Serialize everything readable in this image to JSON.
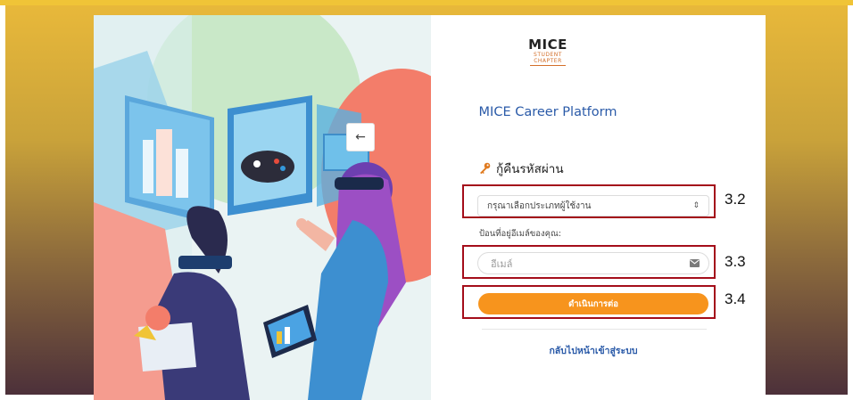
{
  "back_button": {
    "icon": "arrow-left-icon",
    "glyph": "←"
  },
  "logo": {
    "title": "MICE",
    "line1": "STUDENT",
    "line2": "CHAPTER"
  },
  "platform_title": "MICE Career Platform",
  "section": {
    "icon": "key-icon",
    "title": "กู้คืนรหัสผ่าน"
  },
  "user_type_select": {
    "selected": "กรุณาเลือกประเภทผู้ใช้งาน",
    "icon": "sort-icon",
    "glyph": "⇕"
  },
  "email_label": "ป้อนที่อยู่อีเมล์ของคุณ:",
  "email_input": {
    "placeholder": "อีเมล์",
    "icon": "envelope-icon"
  },
  "continue_button": "ดำเนินการต่อ",
  "back_to_login": "กลับไปหน้าเข้าสู่ระบบ",
  "annotations": [
    "3.2",
    "3.3",
    "3.4"
  ],
  "colors": {
    "accent_orange": "#f7941d",
    "link_blue": "#2a5aa8",
    "annotation_red": "#a40d1a"
  }
}
